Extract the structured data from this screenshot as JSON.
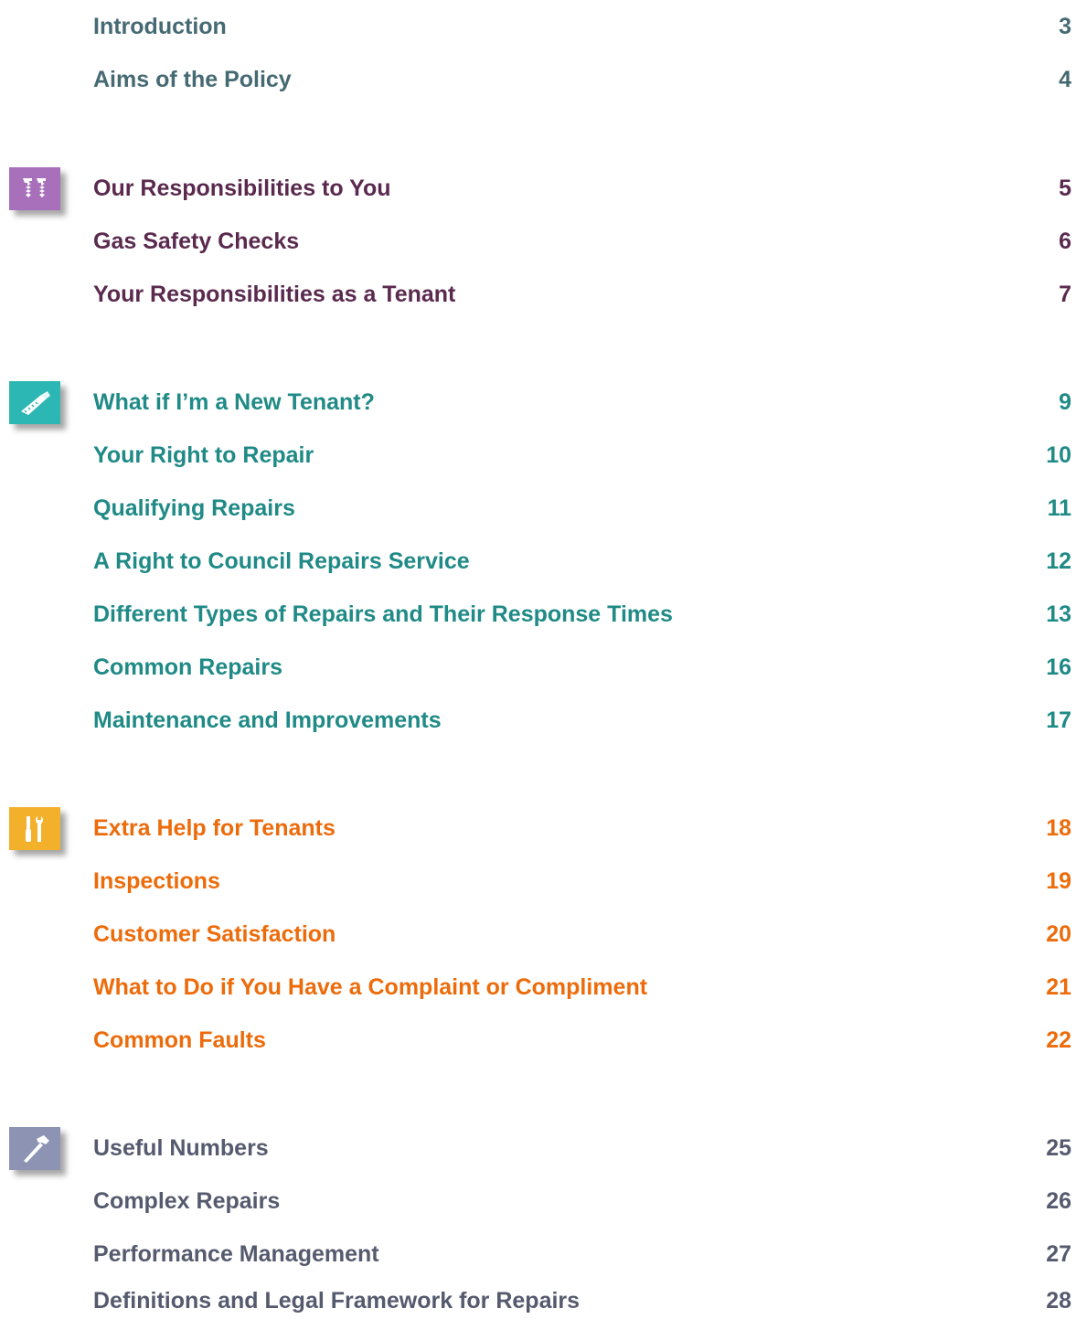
{
  "groups": [
    {
      "color": "#466a73",
      "entries": [
        {
          "title": "Introduction",
          "page": "3"
        },
        {
          "title": "Aims of the Policy",
          "page": "4"
        }
      ]
    },
    {
      "color": "#5a2a4e",
      "icon": "screws-icon",
      "icon_color": "#a870ba",
      "entries": [
        {
          "title": "Our Responsibilities to You",
          "page": "5"
        },
        {
          "title": "Gas Safety Checks",
          "page": "6"
        },
        {
          "title": "Your Responsibilities as a Tenant",
          "page": "7"
        }
      ]
    },
    {
      "color": "#1f8a86",
      "icon": "saw-icon",
      "icon_color": "#2cb6b4",
      "entries": [
        {
          "title": "What if I’m a New Tenant?",
          "page": "9"
        },
        {
          "title": "Your Right to Repair",
          "page": "10"
        },
        {
          "title": "Qualifying Repairs",
          "page": "11"
        },
        {
          "title": "A Right to Council Repairs Service",
          "page": "12"
        },
        {
          "title": "Different Types of Repairs and Their Response Times",
          "page": "13"
        },
        {
          "title": "Common Repairs",
          "page": "16"
        },
        {
          "title": "Maintenance and Improvements",
          "page": "17"
        }
      ]
    },
    {
      "color": "#ec6c0c",
      "icon": "screwdriver-wrench-icon",
      "icon_color": "#f3b02a",
      "entries": [
        {
          "title": "Extra Help for Tenants",
          "page": "18"
        },
        {
          "title": "Inspections",
          "page": "19"
        },
        {
          "title": "Customer Satisfaction",
          "page": "20"
        },
        {
          "title": "What to Do if You Have a Complaint or Compliment",
          "page": "21"
        },
        {
          "title": "Common Faults",
          "page": "22"
        }
      ]
    },
    {
      "color": "#555a6e",
      "icon": "hammer-icon",
      "icon_color": "#8c93b3",
      "entries": [
        {
          "title": "Useful Numbers",
          "page": "25"
        },
        {
          "title": "Complex Repairs",
          "page": "26"
        },
        {
          "title": "Performance Management",
          "page": "27"
        },
        {
          "title": "Definitions and Legal Framework for Repairs",
          "page": "28"
        }
      ]
    }
  ]
}
